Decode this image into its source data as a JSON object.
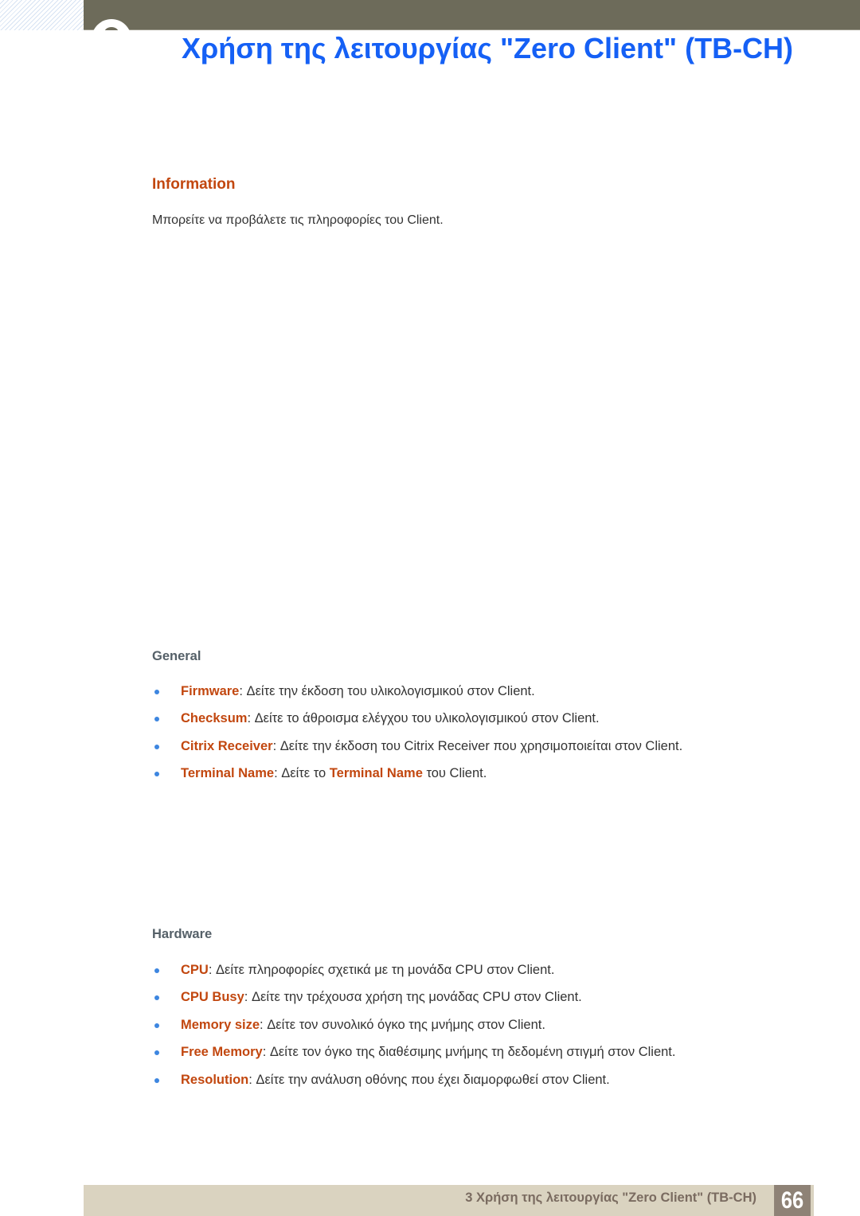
{
  "header": {
    "title": "Χρήση της λειτουργίας \"Zero Client\" (TB-CH)"
  },
  "section": {
    "title": "Information",
    "intro": "Μπορείτε να προβάλετε τις πληροφορίες του Client."
  },
  "general": {
    "title": "General",
    "items": [
      {
        "term": "Firmware",
        "text": ": Δείτε την έκδοση του υλικολογισμικού στον Client."
      },
      {
        "term": "Checksum",
        "text": ": Δείτε το άθροισμα ελέγχου του υλικολογισμικού στον Client."
      },
      {
        "term": "Citrix Receiver",
        "text": ": Δείτε την έκδοση του Citrix Receiver που χρησιμοποιείται στον Client."
      },
      {
        "term": "Terminal Name",
        "text": ": Δείτε το ",
        "term2": "Terminal Name",
        "text2": " του Client."
      }
    ]
  },
  "hardware": {
    "title": "Hardware",
    "items": [
      {
        "term": "CPU",
        "text": ": Δείτε πληροφορίες σχετικά με τη μονάδα CPU στον Client."
      },
      {
        "term": "CPU Busy",
        "text": ": Δείτε την τρέχουσα χρήση της μονάδας CPU στον Client."
      },
      {
        "term": "Memory size",
        "text": ": Δείτε τον συνολικό όγκο της μνήμης στον Client."
      },
      {
        "term": "Free Memory",
        "text": ": Δείτε τον όγκο της διαθέσιμης μνήμης τη δεδομένη στιγμή στον Client."
      },
      {
        "term": "Resolution",
        "text": ": Δείτε την ανάλυση οθόνης που έχει διαμορφωθεί στον Client."
      }
    ]
  },
  "footer": {
    "chapter_text": "3 Χρήση της λειτουργίας \"Zero Client\" (TB-CH)",
    "page_number": "66"
  },
  "colors": {
    "title_blue": "#1560f5",
    "term_orange": "#c2470f",
    "header_bar": "#6d6b5a",
    "footer_bar": "#dad3c0",
    "page_box": "#8e8276",
    "bullet_blue": "#3d86e0"
  }
}
